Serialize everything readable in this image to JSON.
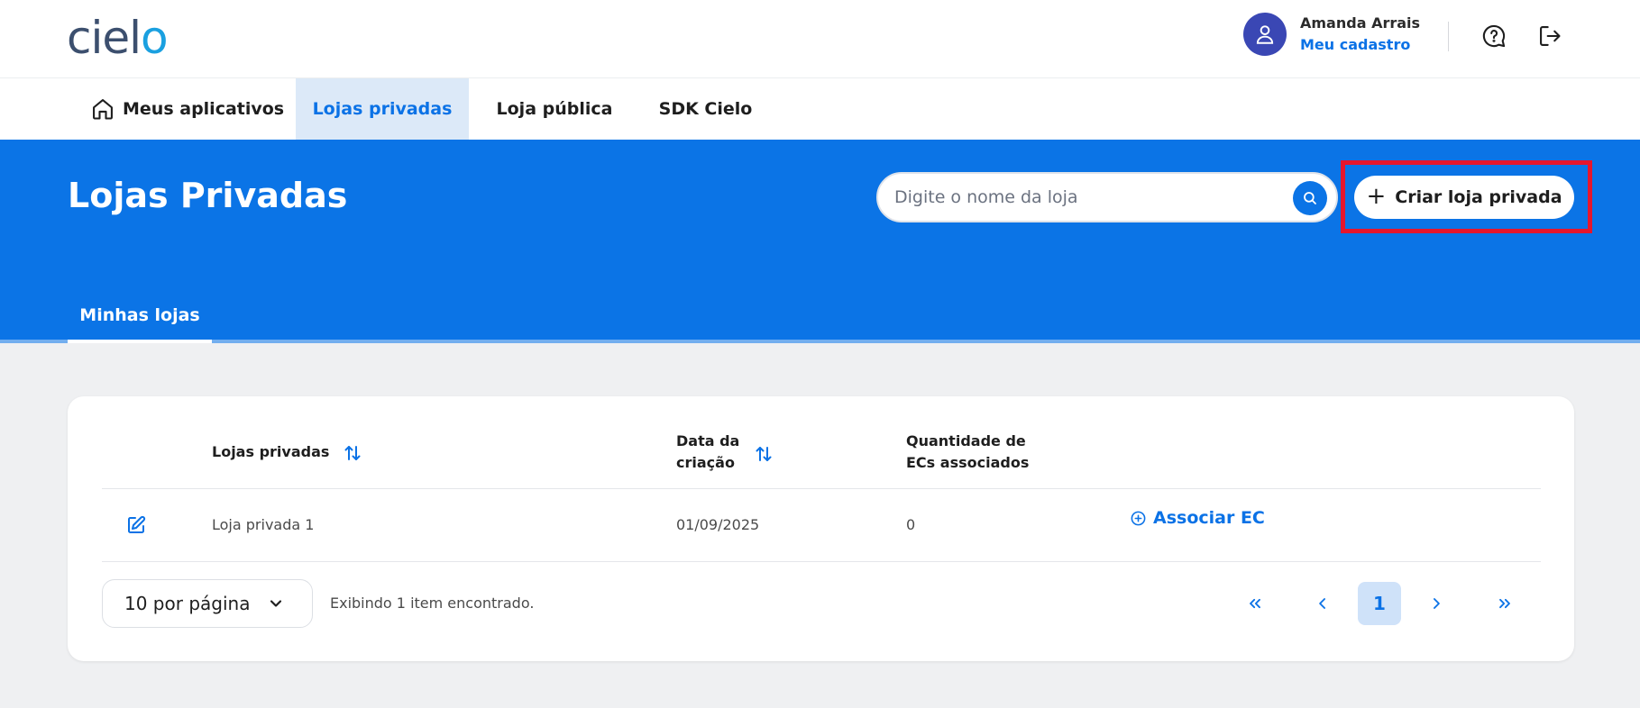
{
  "header": {
    "logo_text_main": "ciel",
    "logo_text_accent": "o",
    "user_name": "Amanda Arrais",
    "user_link": "Meu cadastro"
  },
  "nav": {
    "items": [
      {
        "label": "Meus aplicativos",
        "icon": "home-icon",
        "active": false
      },
      {
        "label": "Lojas privadas",
        "active": true
      },
      {
        "label": "Loja pública",
        "active": false
      },
      {
        "label": "SDK Cielo",
        "active": false
      }
    ]
  },
  "hero": {
    "title": "Lojas Privadas",
    "search_placeholder": "Digite o nome da loja",
    "create_button": "Criar loja privada",
    "tab": "Minhas lojas"
  },
  "table": {
    "headers": {
      "name": "Lojas privadas",
      "date_line1": "Data da",
      "date_line2": "criação",
      "qty_line1": "Quantidade de",
      "qty_line2": "ECs associados"
    },
    "rows": [
      {
        "name": "Loja privada 1",
        "date": "01/09/2025",
        "qty": "0",
        "action": "Associar EC"
      }
    ]
  },
  "pagination": {
    "per_page": "10 por página",
    "showing": "Exibindo 1 item encontrado.",
    "first": "«",
    "prev": "‹",
    "current": "1",
    "next": "›",
    "last": "»"
  },
  "colors": {
    "primary": "#0b74e6",
    "highlight": "#e6162d",
    "avatar": "#3a47b4",
    "logo_accent": "#1aa0e0"
  }
}
